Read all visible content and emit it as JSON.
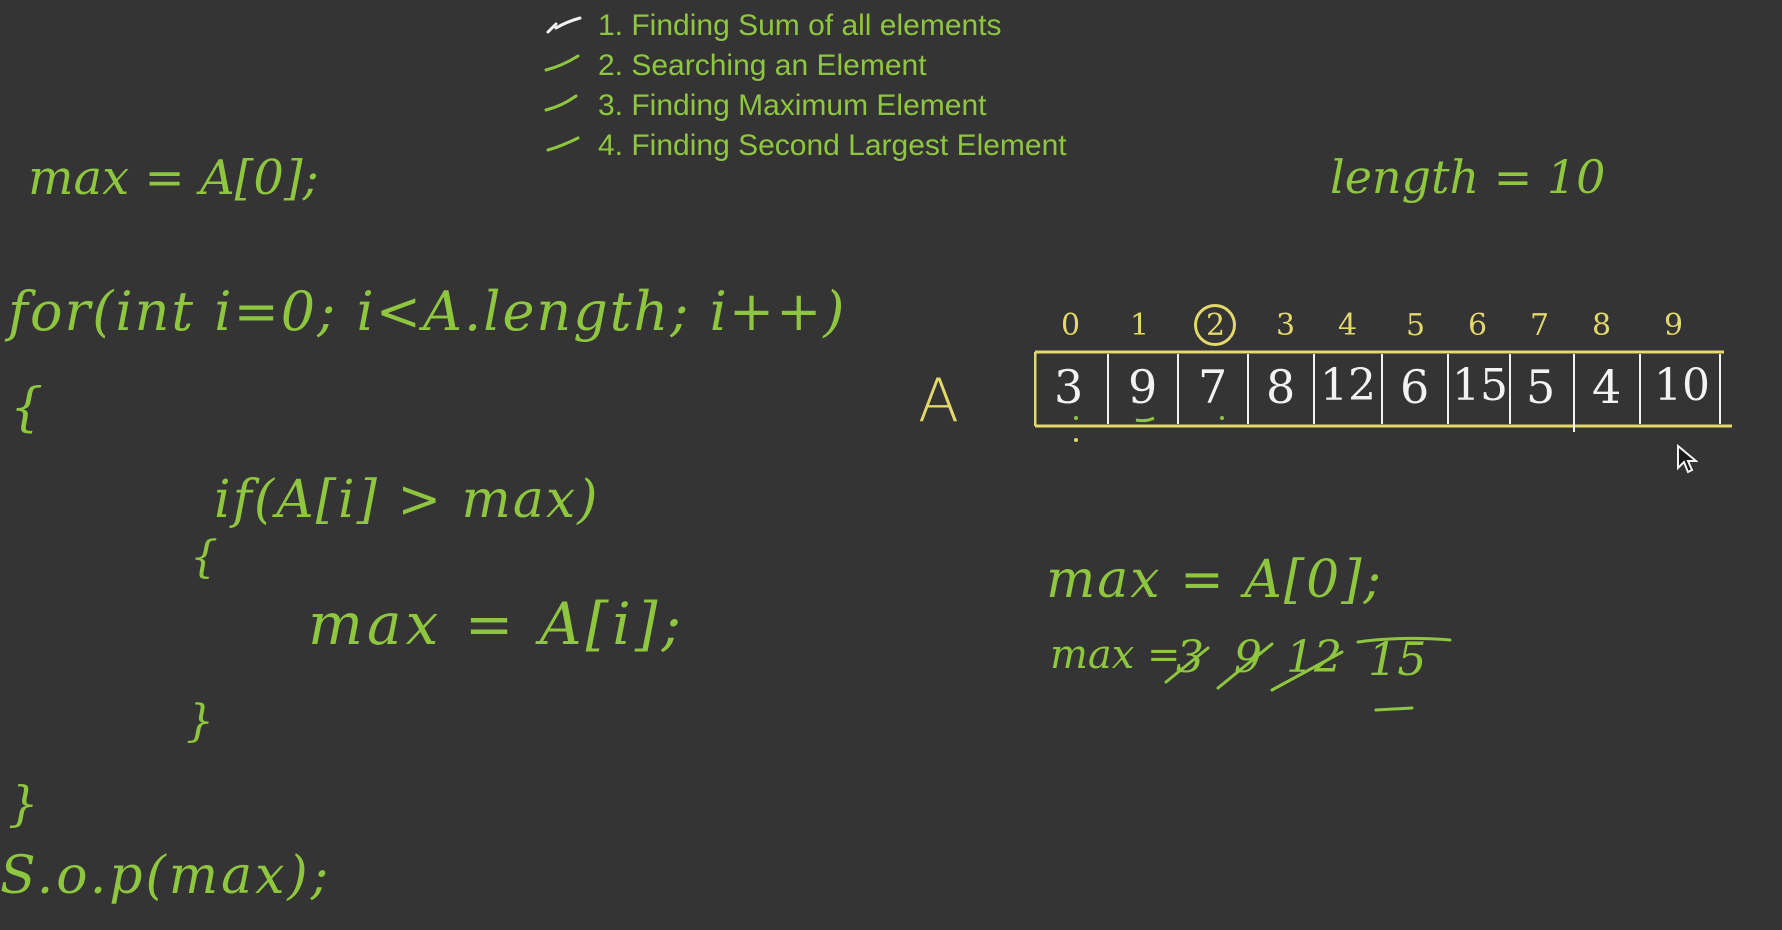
{
  "topics": [
    "1. Finding Sum of all elements",
    "2. Searching an Element",
    "3. Finding Maximum Element",
    "4. Finding Second Largest Element"
  ],
  "code": {
    "init": "max = A[0];",
    "for_line": "for(int i=0; i<A.length; i++)",
    "open_brace": "{",
    "if_line": "if(A[i] > max)",
    "if_open": "{",
    "assign": "max = A[i];",
    "if_close": "}",
    "close_brace": "}",
    "print": "S.o.p(max);"
  },
  "length_note": "length = 10",
  "array": {
    "name": "A",
    "indices": [
      "0",
      "1",
      "2",
      "3",
      "4",
      "5",
      "6",
      "7",
      "8",
      "9"
    ],
    "values": [
      "3",
      "9",
      "7",
      "8",
      "12",
      "6",
      "15",
      "5",
      "4",
      "10"
    ],
    "circled_index": "2"
  },
  "trace": {
    "init": "max = A[0];",
    "label": "max =",
    "struck_values": [
      "3",
      "9",
      "12"
    ],
    "final_value": "15"
  },
  "colors": {
    "background": "#343434",
    "ink_green": "#8fc63f",
    "ink_yellow": "#e2d86c"
  },
  "icons": {
    "cursor": "mouse-pointer-icon"
  }
}
